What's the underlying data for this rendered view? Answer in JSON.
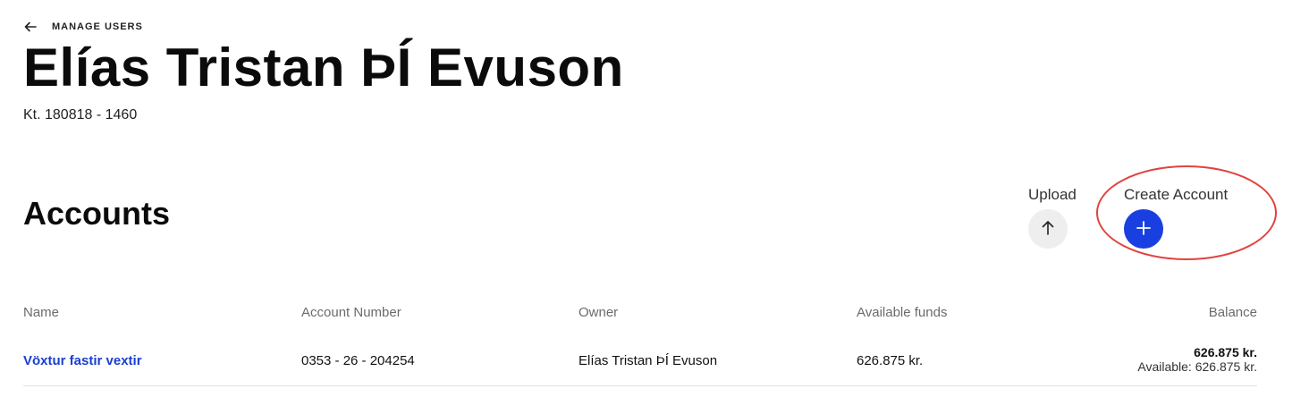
{
  "nav": {
    "back_label": "MANAGE USERS"
  },
  "user": {
    "name": "Elías Tristan ÞÍ Evuson",
    "kennitala": "Kt. 180818 - 1460"
  },
  "accounts": {
    "title": "Accounts",
    "upload_label": "Upload",
    "create_label": "Create Account",
    "columns": [
      "Name",
      "Account Number",
      "Owner",
      "Available funds",
      "Balance"
    ],
    "rows": [
      {
        "name": "Vöxtur fastir vextir",
        "number": "0353 - 26 - 204254",
        "owner": "Elías Tristan ÞÍ Evuson",
        "available": "626.875 kr.",
        "balance": "626.875 kr.",
        "balance_available": "Available: 626.875 kr."
      }
    ]
  },
  "colors": {
    "accent": "#1a3fe0",
    "highlight": "#e0433f",
    "link": "#1a3fd0"
  },
  "icons": {
    "back": "arrow-left-icon",
    "upload": "arrow-up-icon",
    "create": "plus-icon"
  }
}
